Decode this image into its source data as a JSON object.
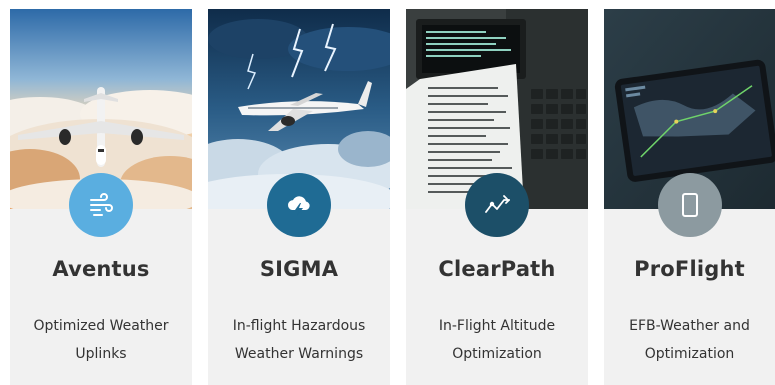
{
  "cards": [
    {
      "title": "Aventus",
      "description": "Optimized Weather Uplinks",
      "icon": "wind-icon",
      "icon_color": "#5aaee0",
      "image": "airplane-above-clouds"
    },
    {
      "title": "SIGMA",
      "description": "In-flight Hazardous Weather Warnings",
      "icon": "storm-cloud-icon",
      "icon_color": "#1f6b94",
      "image": "airplane-in-thunderstorm"
    },
    {
      "title": "ClearPath",
      "description": "In-Flight Altitude Optimization",
      "icon": "flight-path-icon",
      "icon_color": "#1c4f68",
      "image": "cockpit-printout"
    },
    {
      "title": "ProFlight",
      "description": "EFB-Weather and Optimization",
      "icon": "tablet-icon",
      "icon_color": "#8c9aa0",
      "image": "tablet-weather-map"
    }
  ]
}
